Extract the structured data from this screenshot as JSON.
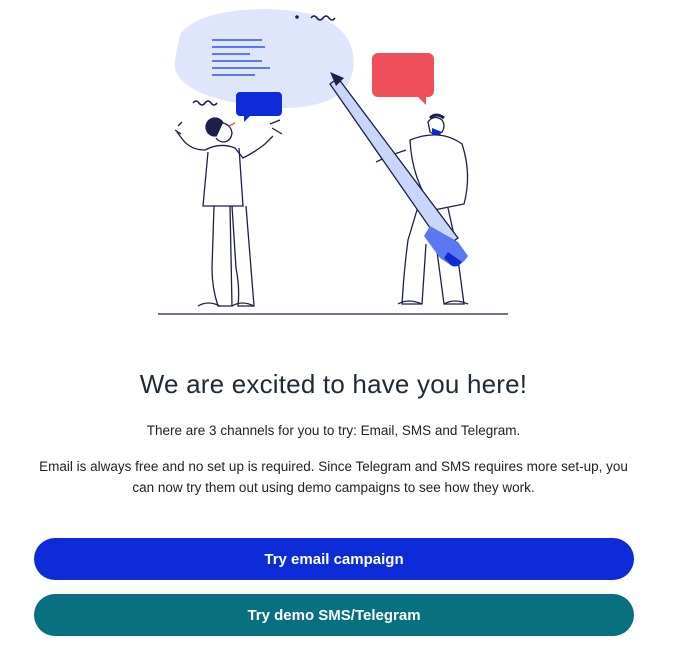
{
  "hero": {
    "illustration_icon": "people-with-pencil-and-speech-bubbles-illustration",
    "colors": {
      "line": "#1b1f4a",
      "blob": "#dfe6fb",
      "accent_blue": "#0d2bd6",
      "accent_red": "#ef4f5a",
      "pencil_fill": "#c9d5fb"
    }
  },
  "content": {
    "title": "We are excited to have you here!",
    "intro": "There are 3 channels for you to try: Email, SMS and Telegram.",
    "details": "Email is always free and no set up is required. Since Telegram and SMS requires more set-up, you can now try them out using demo campaigns to see how they work."
  },
  "actions": {
    "email_label": "Try email campaign",
    "email_color": "#0d2bd6",
    "demo_label": "Try demo SMS/Telegram",
    "demo_color": "#08707f"
  }
}
